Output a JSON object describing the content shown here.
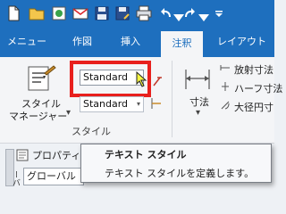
{
  "ribbon_tabs": [
    {
      "label": "メニュー"
    },
    {
      "label": "作図"
    },
    {
      "label": "挿入"
    },
    {
      "label": "注釈"
    },
    {
      "label": "レイアウト"
    }
  ],
  "quick_access": {
    "icons": [
      "new-icon",
      "open-icon",
      "recent-icon",
      "email-icon",
      "save-icon",
      "saveas-icon",
      "print-icon",
      "undo-icon",
      "redo-icon",
      "customize-icon"
    ]
  },
  "style_group": {
    "manager_label_line1": "スタイル",
    "manager_label_line2": "マネージャー",
    "manager_arrow": "▾",
    "text_style_value": "Standard",
    "dim_style_value": "Standard",
    "group_title": "スタイル"
  },
  "dimension_group": {
    "label": "寸法",
    "arrow": "▾",
    "items": [
      {
        "label": "放射寸法"
      },
      {
        "label": "ハーフ寸法"
      },
      {
        "label": "大径円寸"
      }
    ]
  },
  "panel": {
    "title": "プロパティ",
    "field_value": "グローバル",
    "side_label": "ーバ"
  },
  "tooltip": {
    "title": "テキスト スタイル",
    "description": "テキスト スタイルを定義します。"
  },
  "colors": {
    "ribbon_blue": "#1e6fbe",
    "highlight_red": "#e8201d"
  }
}
